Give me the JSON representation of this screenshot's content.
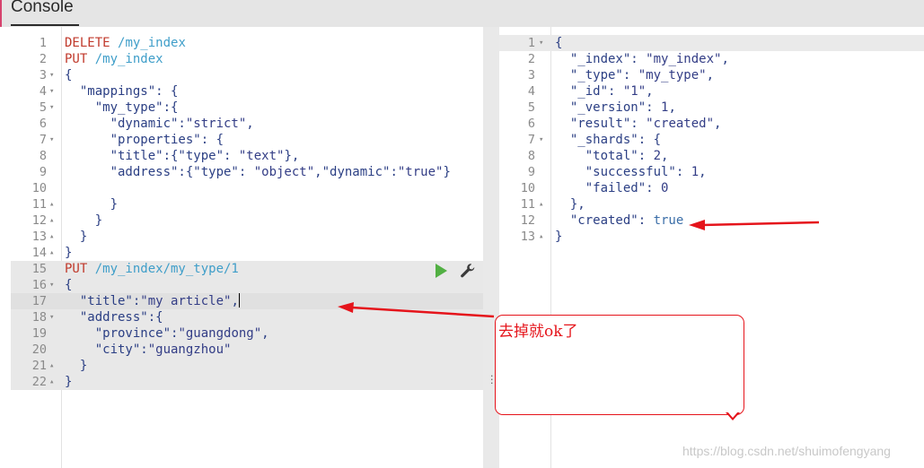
{
  "header": {
    "title": "Console"
  },
  "editor": {
    "lines": [
      {
        "n": "1",
        "fold": "",
        "segs": [
          [
            "DELETE ",
            "kw-method"
          ],
          [
            "/my_index",
            "kw-url"
          ]
        ]
      },
      {
        "n": "2",
        "fold": "",
        "segs": [
          [
            "PUT ",
            "kw-method"
          ],
          [
            "/my_index",
            "kw-url"
          ]
        ]
      },
      {
        "n": "3",
        "fold": "▾",
        "segs": [
          [
            "{",
            ""
          ]
        ]
      },
      {
        "n": "4",
        "fold": "▾",
        "segs": [
          [
            "  \"mappings\": {",
            ""
          ]
        ]
      },
      {
        "n": "5",
        "fold": "▾",
        "segs": [
          [
            "    \"my_type\":{",
            ""
          ]
        ]
      },
      {
        "n": "6",
        "fold": "",
        "segs": [
          [
            "      \"dynamic\":",
            ""
          ],
          [
            "\"strict\"",
            "kw-str"
          ],
          [
            ",",
            ""
          ]
        ]
      },
      {
        "n": "7",
        "fold": "▾",
        "segs": [
          [
            "      \"properties\": {",
            ""
          ]
        ]
      },
      {
        "n": "8",
        "fold": "",
        "segs": [
          [
            "      \"title\":{\"type\": ",
            ""
          ],
          [
            "\"text\"",
            "kw-str"
          ],
          [
            "},",
            ""
          ]
        ]
      },
      {
        "n": "9",
        "fold": "",
        "segs": [
          [
            "      \"address\":{\"type\": ",
            ""
          ],
          [
            "\"object\"",
            "kw-str"
          ],
          [
            ",\"dynamic\":",
            ""
          ],
          [
            "\"true\"",
            "kw-str"
          ],
          [
            "}",
            ""
          ]
        ]
      },
      {
        "n": "10",
        "fold": "",
        "segs": [
          [
            "",
            ""
          ]
        ]
      },
      {
        "n": "11",
        "fold": "▴",
        "segs": [
          [
            "      }",
            ""
          ]
        ]
      },
      {
        "n": "12",
        "fold": "▴",
        "segs": [
          [
            "    }",
            ""
          ]
        ]
      },
      {
        "n": "13",
        "fold": "▴",
        "segs": [
          [
            "  }",
            ""
          ]
        ]
      },
      {
        "n": "14",
        "fold": "▴",
        "segs": [
          [
            "}",
            ""
          ]
        ]
      },
      {
        "n": "15",
        "fold": "",
        "segs": [
          [
            "PUT ",
            "kw-method"
          ],
          [
            "/my_index/my_type/1",
            "kw-url"
          ]
        ]
      },
      {
        "n": "16",
        "fold": "▾",
        "segs": [
          [
            "{",
            ""
          ]
        ]
      },
      {
        "n": "17",
        "fold": "",
        "segs": [
          [
            "  \"title\":",
            ""
          ],
          [
            "\"my article\"",
            "kw-str"
          ],
          [
            ",",
            ""
          ]
        ]
      },
      {
        "n": "18",
        "fold": "▾",
        "segs": [
          [
            "  \"address\":{",
            ""
          ]
        ]
      },
      {
        "n": "19",
        "fold": "",
        "segs": [
          [
            "    \"province\":",
            ""
          ],
          [
            "\"guangdong\"",
            "kw-str"
          ],
          [
            ",",
            ""
          ]
        ]
      },
      {
        "n": "20",
        "fold": "",
        "segs": [
          [
            "    \"city\":",
            ""
          ],
          [
            "\"guangzhou\"",
            "kw-str"
          ]
        ]
      },
      {
        "n": "21",
        "fold": "▴",
        "segs": [
          [
            "  }",
            ""
          ]
        ]
      },
      {
        "n": "22",
        "fold": "▴",
        "segs": [
          [
            "}",
            ""
          ]
        ]
      }
    ]
  },
  "output": {
    "lines": [
      {
        "n": "1",
        "fold": "▾",
        "segs": [
          [
            "{",
            ""
          ]
        ]
      },
      {
        "n": "2",
        "fold": "",
        "segs": [
          [
            "  \"_index\": ",
            ""
          ],
          [
            "\"my_index\"",
            "kw-str"
          ],
          [
            ",",
            ""
          ]
        ]
      },
      {
        "n": "3",
        "fold": "",
        "segs": [
          [
            "  \"_type\": ",
            ""
          ],
          [
            "\"my_type\"",
            "kw-str"
          ],
          [
            ",",
            ""
          ]
        ]
      },
      {
        "n": "4",
        "fold": "",
        "segs": [
          [
            "  \"_id\": ",
            ""
          ],
          [
            "\"1\"",
            "kw-str"
          ],
          [
            ",",
            ""
          ]
        ]
      },
      {
        "n": "5",
        "fold": "",
        "segs": [
          [
            "  \"_version\": ",
            ""
          ],
          [
            "1",
            "kw-num"
          ],
          [
            ",",
            ""
          ]
        ]
      },
      {
        "n": "6",
        "fold": "",
        "segs": [
          [
            "  \"result\": ",
            ""
          ],
          [
            "\"created\"",
            "kw-str"
          ],
          [
            ",",
            ""
          ]
        ]
      },
      {
        "n": "7",
        "fold": "▾",
        "segs": [
          [
            "  \"_shards\": {",
            ""
          ]
        ]
      },
      {
        "n": "8",
        "fold": "",
        "segs": [
          [
            "    \"total\": ",
            ""
          ],
          [
            "2",
            "kw-num"
          ],
          [
            ",",
            ""
          ]
        ]
      },
      {
        "n": "9",
        "fold": "",
        "segs": [
          [
            "    \"successful\": ",
            ""
          ],
          [
            "1",
            "kw-num"
          ],
          [
            ",",
            ""
          ]
        ]
      },
      {
        "n": "10",
        "fold": "",
        "segs": [
          [
            "    \"failed\": ",
            ""
          ],
          [
            "0",
            "kw-num"
          ]
        ]
      },
      {
        "n": "11",
        "fold": "▴",
        "segs": [
          [
            "  },",
            ""
          ]
        ]
      },
      {
        "n": "12",
        "fold": "",
        "segs": [
          [
            "  \"created\": ",
            ""
          ],
          [
            "true",
            "kw-true"
          ]
        ]
      },
      {
        "n": "13",
        "fold": "▴",
        "segs": [
          [
            "}",
            ""
          ]
        ]
      }
    ]
  },
  "annotation": {
    "callout_text": "去掉就ok了"
  },
  "watermark": {
    "text": "https://blog.csdn.net/shuimofengyang"
  },
  "colors": {
    "accent_red": "#e5141b",
    "play_green": "#52b043"
  }
}
